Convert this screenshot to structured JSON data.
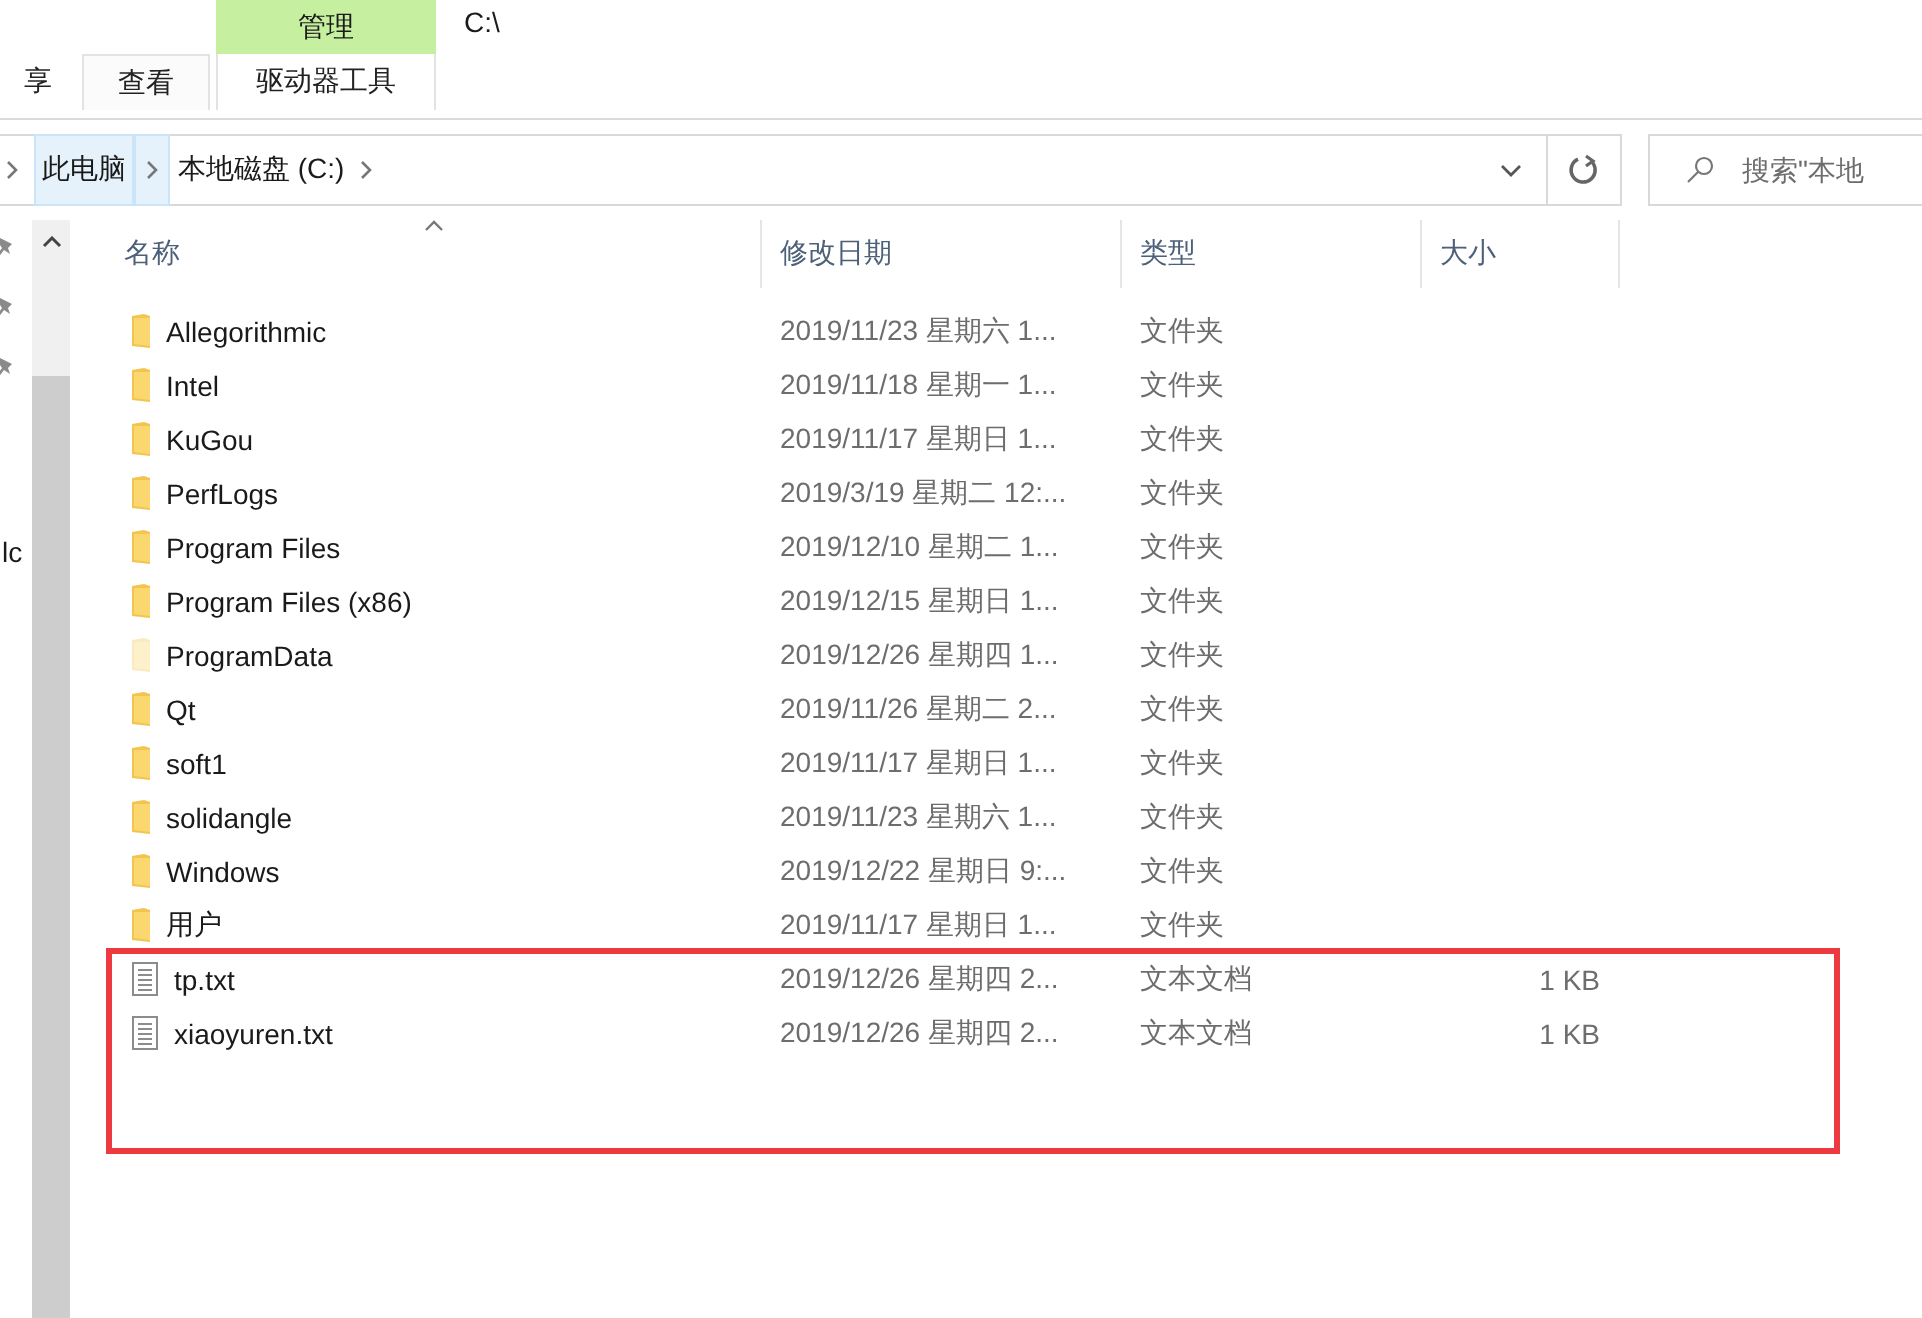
{
  "window": {
    "title": "C:\\"
  },
  "ribbon": {
    "context_group": "管理",
    "tabs": [
      {
        "label": "享",
        "selected": false
      },
      {
        "label": "查看",
        "selected": false
      },
      {
        "label": "驱动器工具",
        "selected": false
      }
    ]
  },
  "address_bar": {
    "crumbs": [
      {
        "label": "此电脑",
        "highlighted": true
      },
      {
        "label": "本地磁盘 (C:)",
        "highlighted": false
      }
    ]
  },
  "search": {
    "placeholder": "搜索\"本地"
  },
  "nav_pane": {
    "pinned_count_label": "lc"
  },
  "table": {
    "columns": [
      {
        "label": "名称",
        "sorted": true
      },
      {
        "label": "修改日期",
        "sorted": false
      },
      {
        "label": "类型",
        "sorted": false
      },
      {
        "label": "大小",
        "sorted": false
      }
    ],
    "rows": [
      {
        "kind": "folder",
        "hidden": false,
        "name": "Allegorithmic",
        "date": "2019/11/23 星期六 1...",
        "type": "文件夹"
      },
      {
        "kind": "folder",
        "hidden": false,
        "name": "Intel",
        "date": "2019/11/18 星期一 1...",
        "type": "文件夹"
      },
      {
        "kind": "folder",
        "hidden": false,
        "name": "KuGou",
        "date": "2019/11/17 星期日 1...",
        "type": "文件夹"
      },
      {
        "kind": "folder",
        "hidden": false,
        "name": "PerfLogs",
        "date": "2019/3/19 星期二 12:...",
        "type": "文件夹"
      },
      {
        "kind": "folder",
        "hidden": false,
        "name": "Program Files",
        "date": "2019/12/10 星期二 1...",
        "type": "文件夹"
      },
      {
        "kind": "folder",
        "hidden": false,
        "name": "Program Files (x86)",
        "date": "2019/12/15 星期日 1...",
        "type": "文件夹"
      },
      {
        "kind": "folder",
        "hidden": true,
        "name": "ProgramData",
        "date": "2019/12/26 星期四 1...",
        "type": "文件夹"
      },
      {
        "kind": "folder",
        "hidden": false,
        "name": "Qt",
        "date": "2019/11/26 星期二 2...",
        "type": "文件夹"
      },
      {
        "kind": "folder",
        "hidden": false,
        "name": "soft1",
        "date": "2019/11/17 星期日 1...",
        "type": "文件夹"
      },
      {
        "kind": "folder",
        "hidden": false,
        "name": "solidangle",
        "date": "2019/11/23 星期六 1...",
        "type": "文件夹"
      },
      {
        "kind": "folder",
        "hidden": false,
        "name": "Windows",
        "date": "2019/12/22 星期日 9:...",
        "type": "文件夹"
      },
      {
        "kind": "folder",
        "hidden": false,
        "name": "用户",
        "date": "2019/11/17 星期日 1...",
        "type": "文件夹"
      },
      {
        "kind": "file",
        "hidden": false,
        "name": "tp.txt",
        "date": "2019/12/26 星期四 2...",
        "type": "文本文档",
        "size": "1 KB"
      },
      {
        "kind": "file",
        "hidden": false,
        "name": "xiaoyuren.txt",
        "date": "2019/12/26 星期四 2...",
        "type": "文本文档",
        "size": "1 KB"
      }
    ]
  }
}
